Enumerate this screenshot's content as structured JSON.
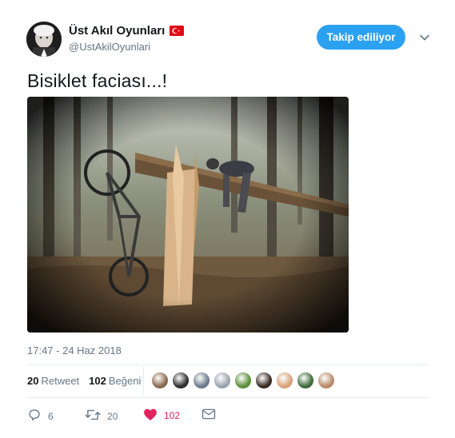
{
  "author": {
    "name": "Üst Akıl Oyunları",
    "handle": "@UstAkilOyunlari"
  },
  "follow_button": {
    "label": "Takip ediliyor"
  },
  "tweet": {
    "text": "Bisiklet faciası...!",
    "timestamp": "17:47 - 24 Haz 2018"
  },
  "stats": {
    "retweets_count": "20",
    "retweets_label": "Retweet",
    "likes_count": "102",
    "likes_label": "Beğeni"
  },
  "likers": [
    {
      "color": "#8a6a4f"
    },
    {
      "color": "#2f2f2f"
    },
    {
      "color": "#6b7a8c"
    },
    {
      "color": "#9aa3ab"
    },
    {
      "color": "#5c8f3a"
    },
    {
      "color": "#3a2a22"
    },
    {
      "color": "#d8a27a"
    },
    {
      "color": "#3f6b3c"
    },
    {
      "color": "#b88a6a"
    }
  ],
  "actions": {
    "reply_count": "6",
    "retweet_count": "20",
    "like_count": "102"
  },
  "colors": {
    "accent": "#1da1f2",
    "like": "#e0245e",
    "muted": "#657786"
  }
}
